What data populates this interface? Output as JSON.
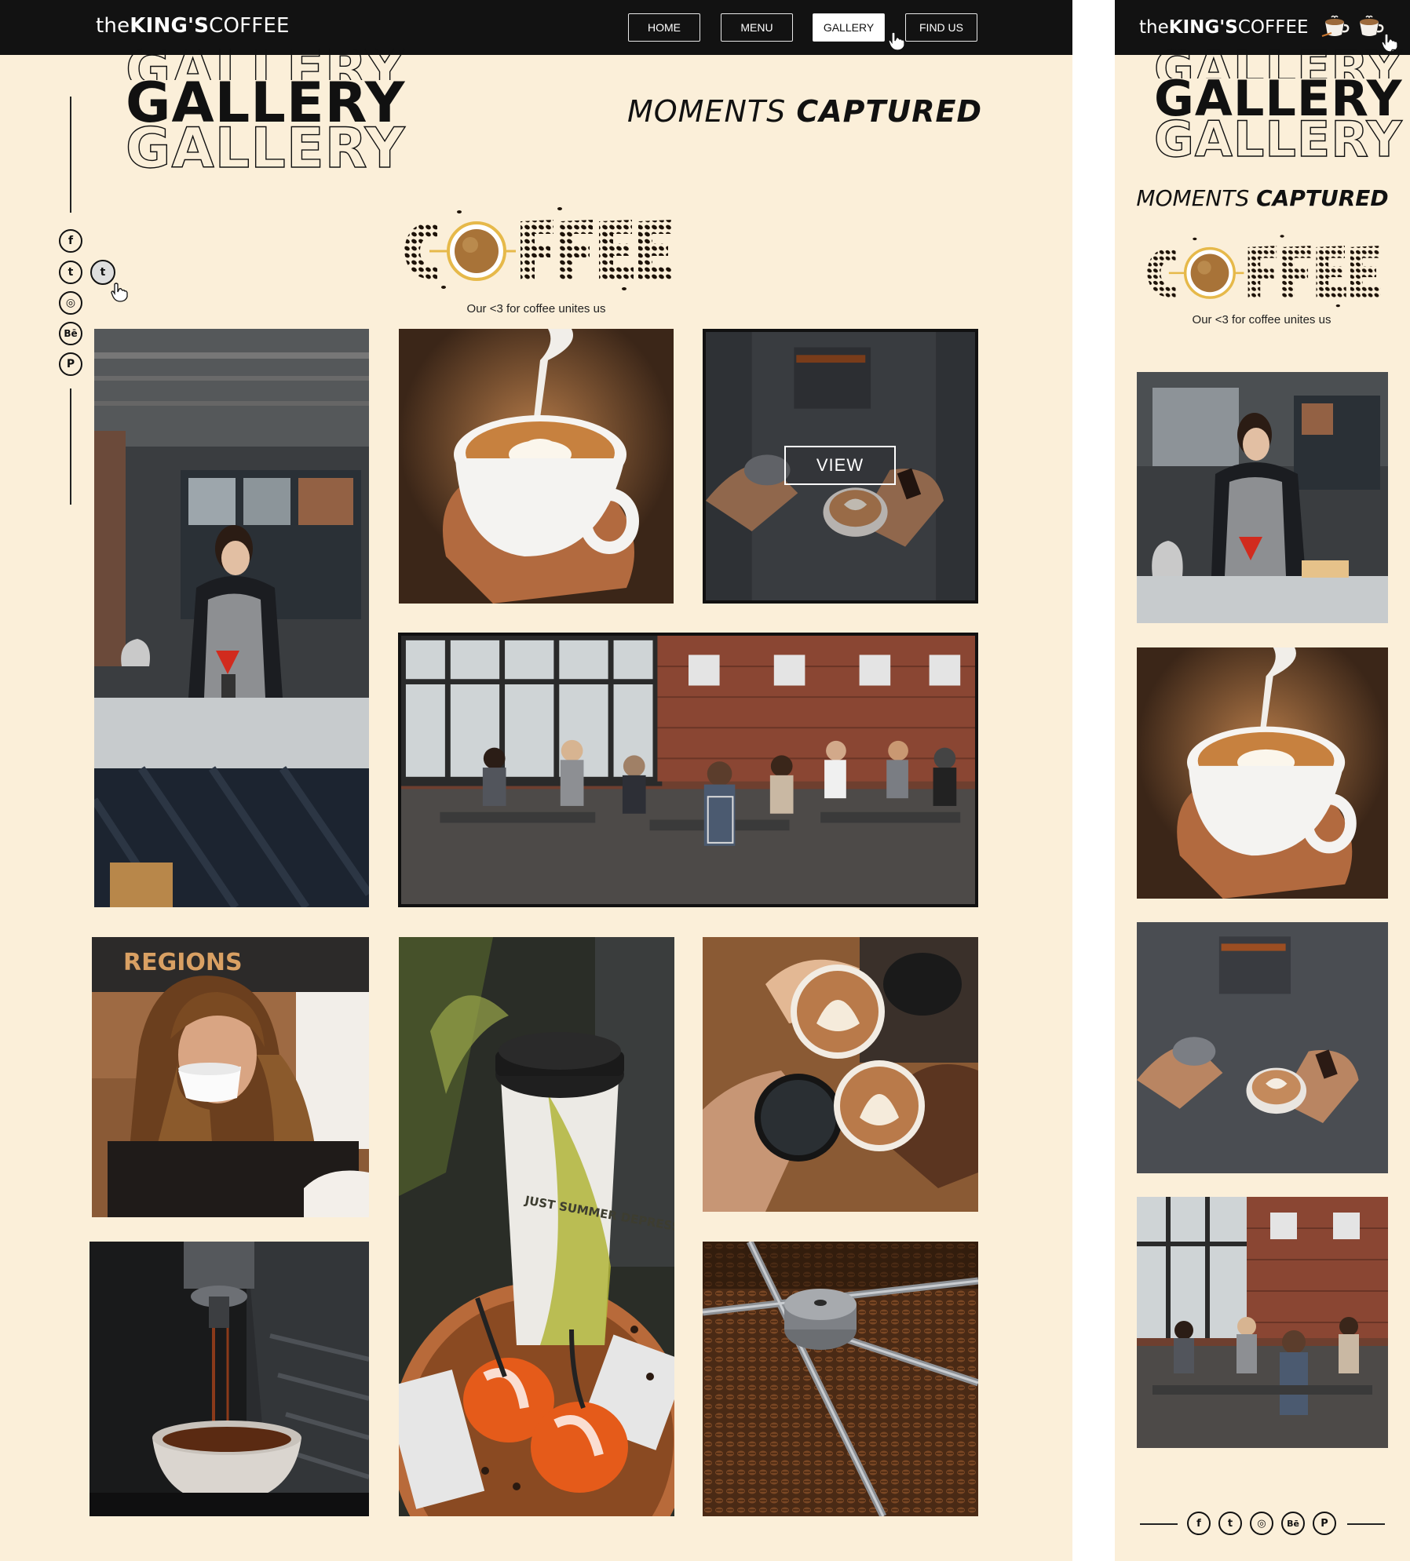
{
  "brand": {
    "prefix": "the",
    "bold": "KING'S",
    "suffix": "COFFEE"
  },
  "nav": [
    {
      "label": "HOME"
    },
    {
      "label": "MENU"
    },
    {
      "label": "GALLERY",
      "active": true
    },
    {
      "label": "FIND US"
    }
  ],
  "hero": {
    "gallery_word": "GALLERY",
    "moments_light": "MOMENTS",
    "moments_bold": "CAPTURED"
  },
  "coffee_logo": {
    "word": "COFFEE",
    "tagline": "Our <3 for coffee unites us"
  },
  "social_icons": [
    "facebook-icon",
    "twitter-icon",
    "instagram-icon",
    "behance-icon",
    "pinterest-icon"
  ],
  "social_glyphs": {
    "facebook": "f",
    "twitter": "t",
    "instagram": "◎",
    "behance": "Bē",
    "pinterest": "P"
  },
  "photos": [
    {
      "name": "barista-pour-over-photo"
    },
    {
      "name": "latte-art-pour-photo"
    },
    {
      "name": "barista-latte-view-photo",
      "overlay_label": "VIEW"
    },
    {
      "name": "cafe-interior-crowd-photo"
    },
    {
      "name": "woman-drinking-coffee-photo",
      "sign_text": "REGIONS"
    },
    {
      "name": "iced-coffee-cup-photo",
      "cup_text": "JUST SUMMER DEPRESSION"
    },
    {
      "name": "cheers-lattes-photo"
    },
    {
      "name": "espresso-machine-photo"
    },
    {
      "name": "coffee-roaster-beans-photo"
    }
  ],
  "colors": {
    "page_bg": "#fbefd9",
    "topbar": "#121212",
    "accent_brown": "#8b5a2b"
  }
}
